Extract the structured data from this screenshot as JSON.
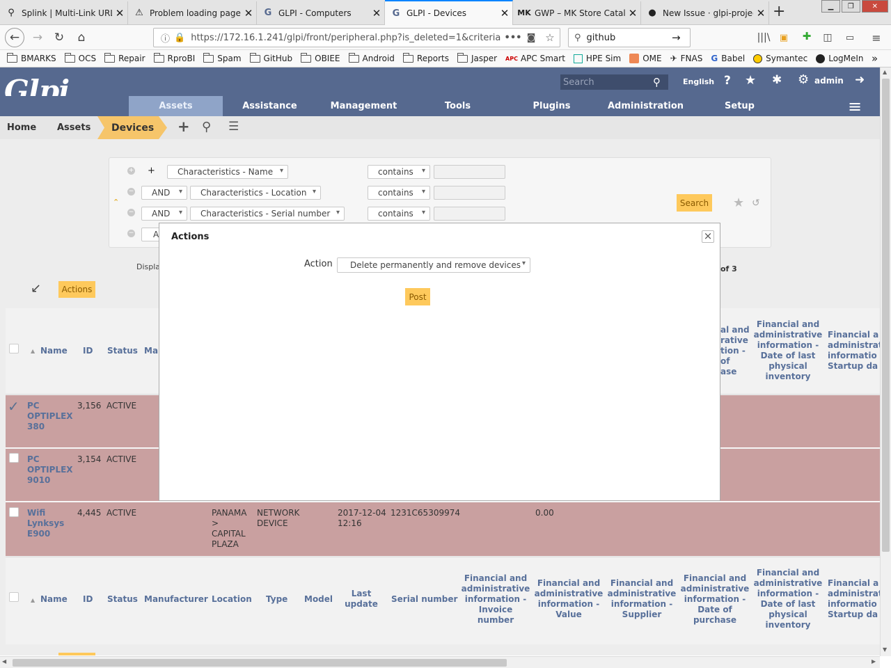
{
  "tabs": [
    {
      "title": "Splink | Multi-Link URL"
    },
    {
      "title": "Problem loading page"
    },
    {
      "title": "GLPI - Computers"
    },
    {
      "title": "GLPI - Devices"
    },
    {
      "title": "GWP – MK Store Catalo"
    },
    {
      "title": "New Issue · glpi-project"
    }
  ],
  "nav": {
    "url": "https://172.16.1.241/glpi/front/peripheral.php?is_deleted=1&criteria",
    "search_value": "github"
  },
  "bookmarks": [
    "BMARKS",
    "OCS",
    "Repair",
    "RproBI",
    "Spam",
    "GitHub",
    "OBIEE",
    "Android",
    "Reports",
    "Jasper",
    "APC Smart",
    "HPE Sim",
    "OME",
    "FNAS",
    "Babel",
    "Symantec",
    "LogMeIn"
  ],
  "header": {
    "logo": "Glpi",
    "search_placeholder": "Search",
    "language": "English",
    "user": "admin"
  },
  "menu": [
    "Assets",
    "Assistance",
    "Management",
    "Tools",
    "Plugins",
    "Administration",
    "Setup"
  ],
  "breadcrumb": {
    "home": "Home",
    "assets": "Assets",
    "current": "Devices"
  },
  "search": {
    "rows": [
      {
        "logic": "",
        "field": "Characteristics - Name",
        "op": "contains"
      },
      {
        "logic": "AND",
        "field": "Characteristics - Location",
        "op": "contains"
      },
      {
        "logic": "AND",
        "field": "Characteristics - Serial number",
        "op": "contains"
      },
      {
        "logic": "A",
        "field": "",
        "op": ""
      }
    ],
    "plus": "+",
    "button": "Search"
  },
  "list": {
    "display_prefix": "Displa",
    "pager_suffix": "of 3",
    "actions_label": "Actions",
    "headers_top": {
      "name": "Name",
      "id": "ID",
      "status": "Status",
      "manufacturer_partial": "Ma",
      "fin_purchase_partial": "al and\nrative\ntion -\nof\nase",
      "fin_inventory": "Financial and\nadministrative\ninformation -\nDate of last\nphysical\ninventory",
      "fin_startup_partial": "Financial a\nadministrat\ninformatio\nStartup da"
    },
    "headers_bottom": {
      "name": "Name",
      "id": "ID",
      "status": "Status",
      "manufacturer": "Manufacturer",
      "location": "Location",
      "type": "Type",
      "model": "Model",
      "last_update": "Last\nupdate",
      "serial": "Serial number",
      "fin_invoice": "Financial and\nadministrative\ninformation -\nInvoice\nnumber",
      "fin_value": "Financial and\nadministrative\ninformation -\nValue",
      "fin_supplier": "Financial and\nadministrative\ninformation -\nSupplier",
      "fin_purchase": "Financial and\nadministrative\ninformation -\nDate of\npurchase",
      "fin_inventory": "Financial and\nadministrative\ninformation -\nDate of last\nphysical\ninventory",
      "fin_startup_partial": "Financial a\nadministrat\ninformatio\nStartup da"
    },
    "rows": [
      {
        "name": "PC\nOPTIPLEX\n380",
        "id": "3,156",
        "status": "ACTIVE",
        "location": "",
        "type": "",
        "last_update": "",
        "serial": "",
        "value": "",
        "checked": true
      },
      {
        "name": "PC\nOPTIPLEX\n9010",
        "id": "3,154",
        "status": "ACTIVE",
        "location": "",
        "type": "",
        "last_update": "",
        "serial": "",
        "value": "",
        "checked": false
      },
      {
        "name": "Wifi\nLynksys\nE900",
        "id": "4,445",
        "status": "ACTIVE",
        "location": "PANAMA\n>\nCAPITAL\nPLAZA",
        "type": "NETWORK\nDEVICE",
        "last_update": "2017-12-04\n12:16",
        "serial": "1231C65309974",
        "value": "0.00",
        "checked": false
      }
    ]
  },
  "modal": {
    "title": "Actions",
    "close": "×",
    "action_label": "Action",
    "action_value": "Delete permanently and remove devices",
    "post": "Post"
  },
  "colors": {
    "header": "#56698f",
    "menu_active": "#8fa4c8",
    "row_bg": "#c9a0a0",
    "yellow": "#fec95c"
  }
}
